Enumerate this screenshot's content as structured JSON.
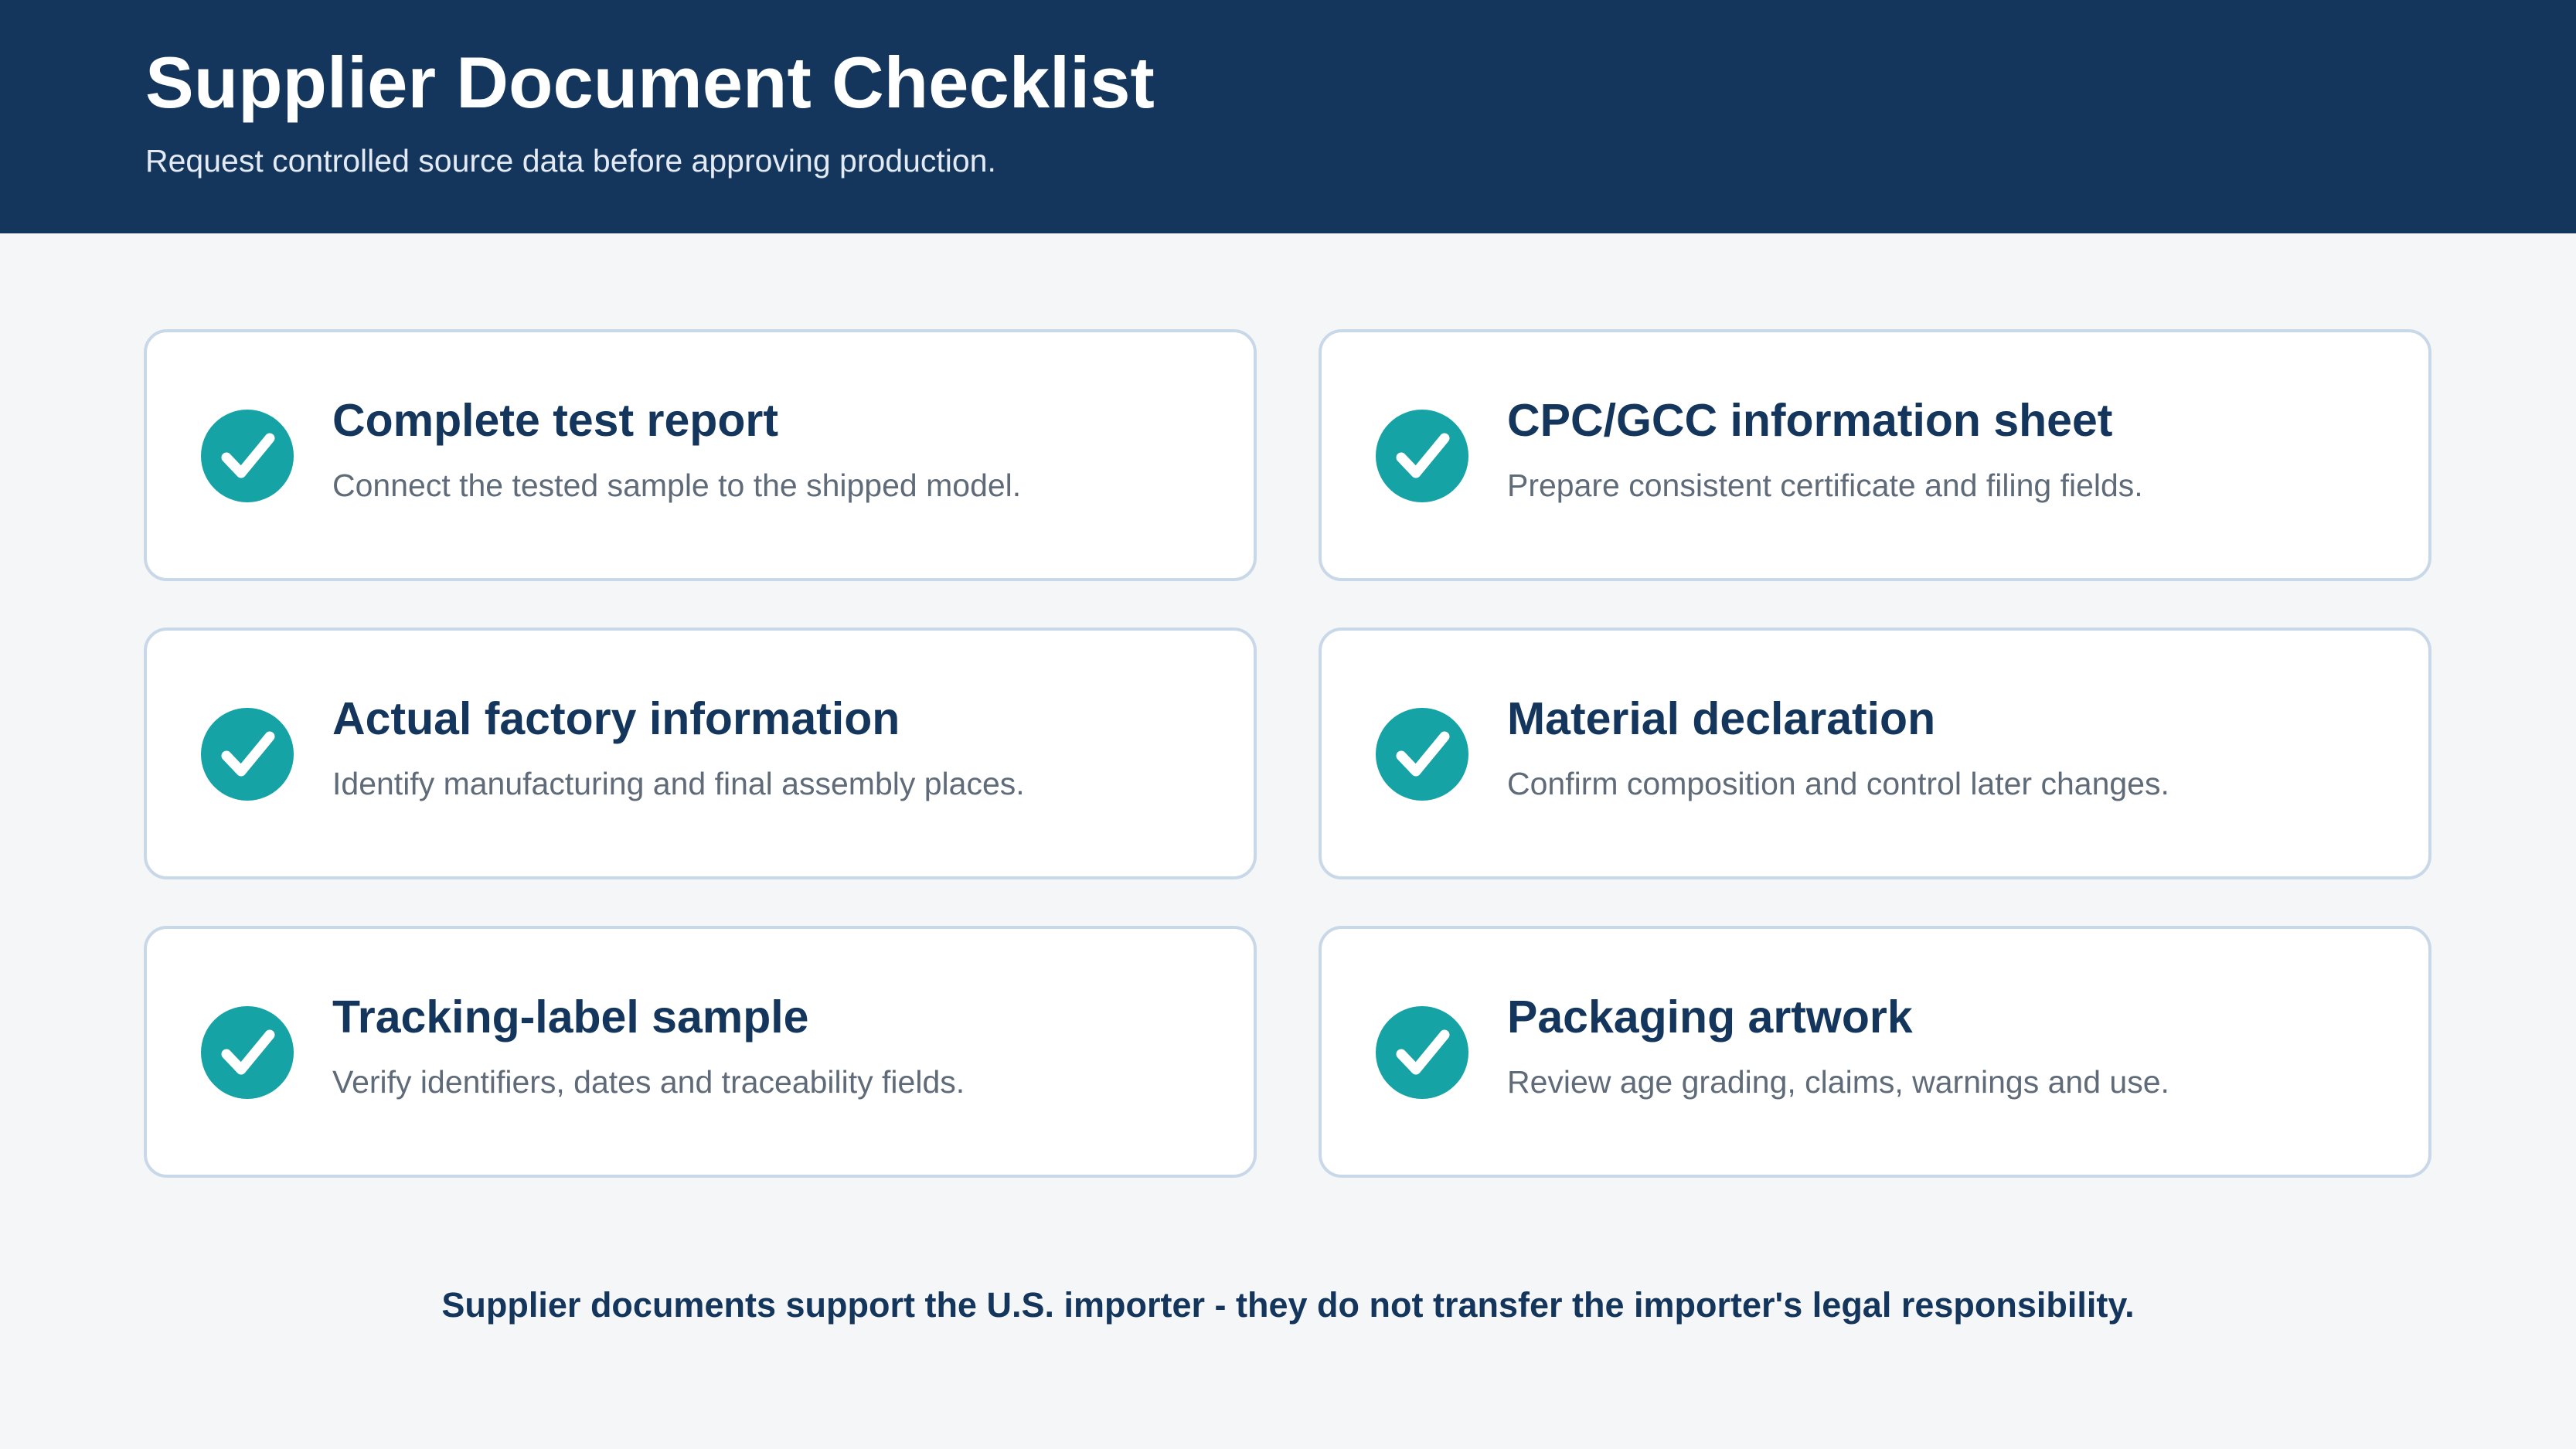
{
  "header": {
    "title": "Supplier Document Checklist",
    "subtitle": "Request controlled source data before approving production."
  },
  "checklist": [
    {
      "icon": "check-circle-icon",
      "title": "Complete test report",
      "description": "Connect the tested sample to the shipped model."
    },
    {
      "icon": "check-circle-icon",
      "title": "CPC/GCC information sheet",
      "description": "Prepare consistent certificate and filing fields."
    },
    {
      "icon": "check-circle-icon",
      "title": "Actual factory information",
      "description": "Identify manufacturing and final assembly places."
    },
    {
      "icon": "check-circle-icon",
      "title": "Material declaration",
      "description": "Confirm composition and control later changes."
    },
    {
      "icon": "check-circle-icon",
      "title": "Tracking-label sample",
      "description": "Verify identifiers, dates and traceability fields."
    },
    {
      "icon": "check-circle-icon",
      "title": "Packaging artwork",
      "description": "Review age grading, claims, warnings and use."
    }
  ],
  "footer": {
    "note": "Supplier documents support the U.S. importer - they do not transfer the importer's legal responsibility."
  },
  "colors": {
    "header_background": "#14365c",
    "page_background": "#f5f6f7",
    "accent_check": "#15a3a5",
    "card_border": "#c8d8e8",
    "title_text": "#14365c",
    "description_text": "#5f6b78"
  }
}
